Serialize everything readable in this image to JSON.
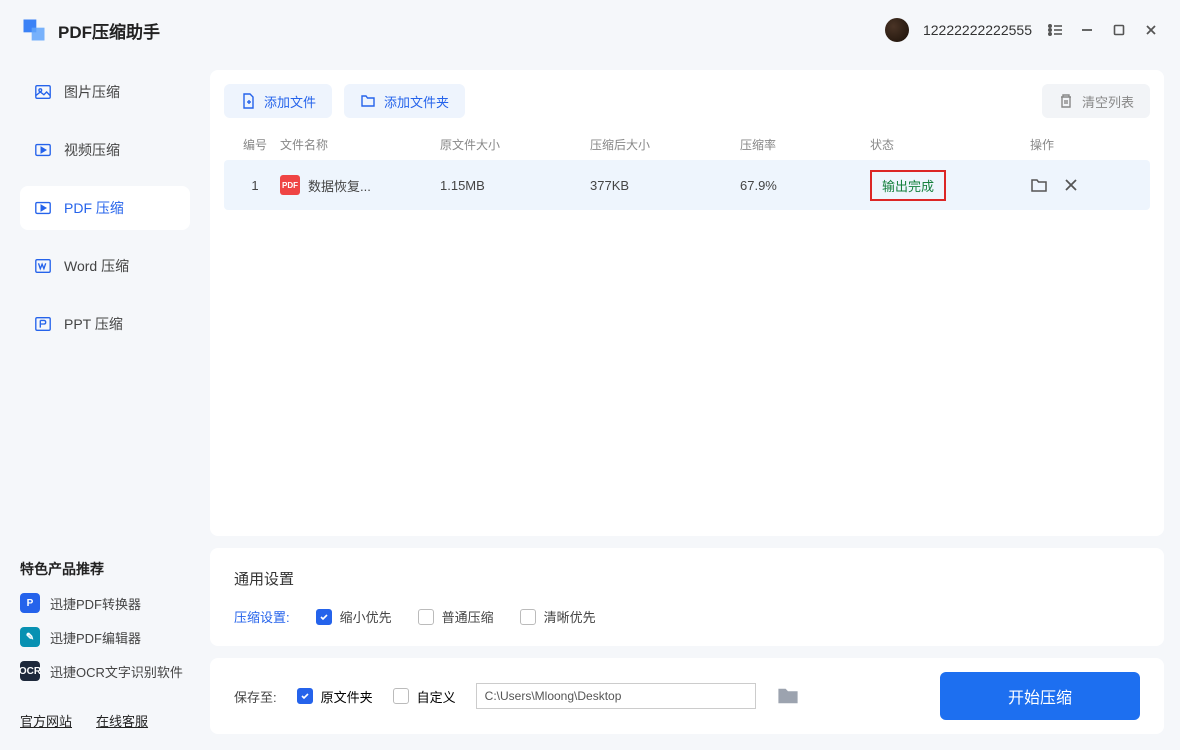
{
  "app": {
    "title": "PDF压缩助手",
    "username": "12222222222555"
  },
  "sidebar": {
    "items": [
      {
        "label": "图片压缩"
      },
      {
        "label": "视频压缩"
      },
      {
        "label": "PDF 压缩"
      },
      {
        "label": "Word 压缩"
      },
      {
        "label": "PPT 压缩"
      }
    ],
    "section_title": "特色产品推荐",
    "recommends": [
      {
        "label": "迅捷PDF转换器"
      },
      {
        "label": "迅捷PDF编辑器"
      },
      {
        "label": "迅捷OCR文字识别软件"
      }
    ],
    "footer": {
      "site": "官方网站",
      "service": "在线客服"
    }
  },
  "toolbar": {
    "add_file": "添加文件",
    "add_folder": "添加文件夹",
    "clear_list": "清空列表"
  },
  "table": {
    "headers": {
      "idx": "编号",
      "name": "文件名称",
      "orig": "原文件大小",
      "after": "压缩后大小",
      "ratio": "压缩率",
      "status": "状态",
      "ops": "操作"
    },
    "rows": [
      {
        "idx": "1",
        "name": "数据恢复...",
        "orig": "1.15MB",
        "after": "377KB",
        "ratio": "67.9%",
        "status": "输出完成"
      }
    ]
  },
  "settings": {
    "title": "通用设置",
    "label": "压缩设置:",
    "options": {
      "small": "缩小优先",
      "normal": "普通压缩",
      "clear": "清晰优先"
    }
  },
  "bottom": {
    "save_to": "保存至:",
    "opt_orig": "原文件夹",
    "opt_custom": "自定义",
    "path": "C:\\Users\\Mloong\\Desktop",
    "start": "开始压缩"
  }
}
